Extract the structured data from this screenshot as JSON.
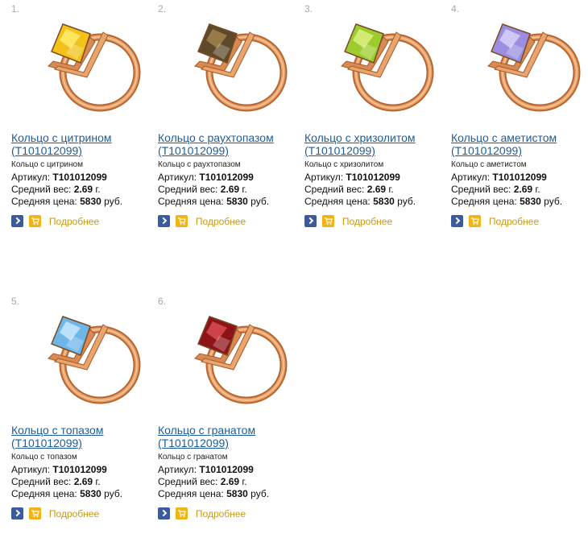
{
  "products": [
    {
      "num": "1.",
      "title_line1": "Кольцо с цитрином",
      "title_line2": "(T101012099)",
      "subtitle": "Кольцо с цитрином",
      "article_label": "Артикул:",
      "article_value": "T101012099",
      "weight_label": "Средний вес:",
      "weight_value": "2.69",
      "weight_unit": "г.",
      "price_label": "Средняя цена:",
      "price_value": "5830",
      "price_unit": "руб.",
      "more_label": "Подробнее",
      "stone_color": "#f2c21a",
      "stone_highlight": "#fff27a"
    },
    {
      "num": "2.",
      "title_line1": "Кольцо с раухтопазом",
      "title_line2": "(T101012099)",
      "subtitle": "Кольцо с раухтопазом",
      "article_label": "Артикул:",
      "article_value": "T101012099",
      "weight_label": "Средний вес:",
      "weight_value": "2.69",
      "weight_unit": "г.",
      "price_label": "Средняя цена:",
      "price_value": "5830",
      "price_unit": "руб.",
      "more_label": "Подробнее",
      "stone_color": "#5e4a2a",
      "stone_highlight": "#a98b52"
    },
    {
      "num": "3.",
      "title_line1": "Кольцо с хризолитом",
      "title_line2": "(T101012099)",
      "subtitle": "Кольцо с хризолитом",
      "article_label": "Артикул:",
      "article_value": "T101012099",
      "weight_label": "Средний вес:",
      "weight_value": "2.69",
      "weight_unit": "г.",
      "price_label": "Средняя цена:",
      "price_value": "5830",
      "price_unit": "руб.",
      "more_label": "Подробнее",
      "stone_color": "#9ccc2e",
      "stone_highlight": "#e4f58a"
    },
    {
      "num": "4.",
      "title_line1": "Кольцо с аметистом",
      "title_line2": "(T101012099)",
      "subtitle": "Кольцо с аметистом",
      "article_label": "Артикул:",
      "article_value": "T101012099",
      "weight_label": "Средний вес:",
      "weight_value": "2.69",
      "weight_unit": "г.",
      "price_label": "Средняя цена:",
      "price_value": "5830",
      "price_unit": "руб.",
      "more_label": "Подробнее",
      "stone_color": "#9b8ee0",
      "stone_highlight": "#e0dbff"
    },
    {
      "num": "5.",
      "title_line1": "Кольцо с топазом",
      "title_line2": "(T101012099)",
      "subtitle": "Кольцо с топазом",
      "article_label": "Артикул:",
      "article_value": "T101012099",
      "weight_label": "Средний вес:",
      "weight_value": "2.69",
      "weight_unit": "г.",
      "price_label": "Средняя цена:",
      "price_value": "5830",
      "price_unit": "руб.",
      "more_label": "Подробнее",
      "stone_color": "#6fb6e8",
      "stone_highlight": "#d3efff"
    },
    {
      "num": "6.",
      "title_line1": "Кольцо с гранатом",
      "title_line2": "(T101012099)",
      "subtitle": "Кольцо с гранатом",
      "article_label": "Артикул:",
      "article_value": "T101012099",
      "weight_label": "Средний вес:",
      "weight_value": "2.69",
      "weight_unit": "г.",
      "price_label": "Средняя цена:",
      "price_value": "5830",
      "price_unit": "руб.",
      "more_label": "Подробнее",
      "stone_color": "#8e1318",
      "stone_highlight": "#e0545a"
    }
  ],
  "icons": {
    "details": "arrow-right-icon",
    "cart": "cart-icon"
  },
  "colors": {
    "link": "#1d5c9a",
    "more_link": "#c99a12",
    "gold": "#d98a52"
  }
}
